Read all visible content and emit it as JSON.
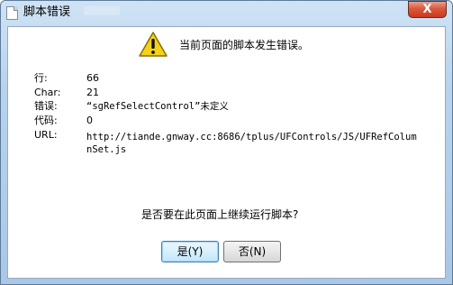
{
  "window": {
    "title": "脚本错误",
    "close_label": "X"
  },
  "message": {
    "headline": "当前页面的脚本发生错误。",
    "question": "是否要在此页面上继续运行脚本?"
  },
  "details": [
    {
      "label": "行:",
      "value": "66"
    },
    {
      "label": "Char:",
      "value": "21"
    },
    {
      "label": "错误:",
      "value": "“sgRefSelectControl”未定义"
    },
    {
      "label": "代码:",
      "value": "0"
    },
    {
      "label": "URL:",
      "value": "http://tiande.gnway.cc:8686/tplus/UFControls/JS/UFRefColumnSet.js"
    }
  ],
  "buttons": {
    "yes_label": "是(Y)",
    "no_label": "否(N)"
  },
  "icons": {
    "warning": "warning-triangle-icon",
    "app": "document-icon",
    "close": "close-icon"
  },
  "colors": {
    "warning_fill": "#f5d21a",
    "close_red": "#d9573c"
  }
}
